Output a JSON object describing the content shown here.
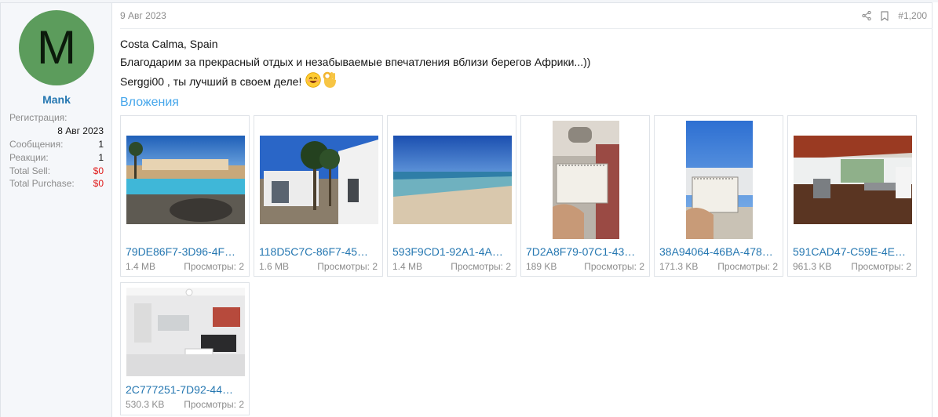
{
  "user": {
    "avatar_letter": "M",
    "name": "Mank",
    "stats": [
      {
        "label": "Регистрация:",
        "value": ""
      },
      {
        "label": "",
        "value": "8 Авг 2023"
      },
      {
        "label": "Сообщения:",
        "value": "1"
      },
      {
        "label": "Реакции:",
        "value": "1"
      },
      {
        "label": "Total Sell:",
        "value": "$0"
      },
      {
        "label": "Total Purchase:",
        "value": "$0"
      }
    ]
  },
  "post": {
    "date": "9 Авг 2023",
    "number": "#1,200",
    "lines": [
      "Costa Calma, Spain",
      "Благодарим за прекрасный отдых и незабываемые впечатления вблизи берегов Африки...))",
      "Serggi00 , ты лучший в своем деле!"
    ],
    "attachments_title": "Вложения",
    "attachments": [
      {
        "name": "79DE86F7-3D96-4F…",
        "size": "1.4 MB",
        "views": "Просмотры: 2"
      },
      {
        "name": "118D5C7C-86F7-45…",
        "size": "1.6 MB",
        "views": "Просмотры: 2"
      },
      {
        "name": "593F9CD1-92A1-4A…",
        "size": "1.4 MB",
        "views": "Просмотры: 2"
      },
      {
        "name": "7D2A8F79-07C1-43…",
        "size": "189 KB",
        "views": "Просмотры: 2"
      },
      {
        "name": "38A94064-46BA-478…",
        "size": "171.3 KB",
        "views": "Просмотры: 2"
      },
      {
        "name": "591CAD47-C59E-4E…",
        "size": "961.3 KB",
        "views": "Просмотры: 2"
      },
      {
        "name": "2C777251-7D92-44…",
        "size": "530.3 KB",
        "views": "Просмотры: 2"
      }
    ]
  },
  "colors": {
    "link": "#2577b1",
    "heading": "#47a7eb",
    "avatar": "#5c9c5c",
    "money": "#e01b1b"
  },
  "icons": [
    "share-icon",
    "bookmark-icon",
    "smile-emoji-icon",
    "ok-hand-emoji-icon"
  ]
}
